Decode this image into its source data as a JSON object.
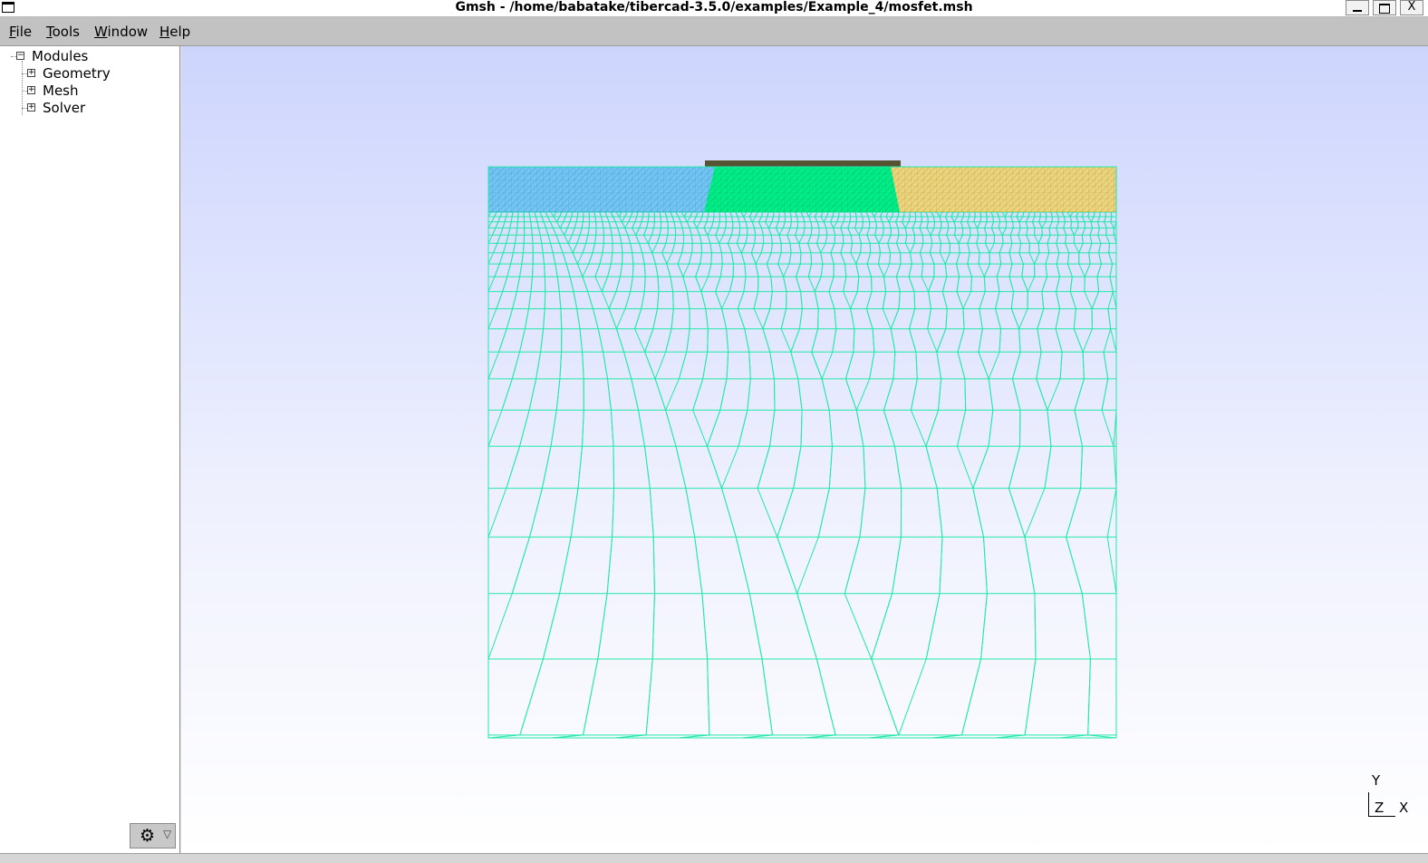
{
  "window": {
    "title": "Gmsh - /home/babatake/tibercad-3.5.0/examples/Example_4/mosfet.msh",
    "close_glyph": "X"
  },
  "menubar": {
    "items": [
      {
        "label": "File",
        "mnemonic": "F",
        "rest": "ile"
      },
      {
        "label": "Tools",
        "mnemonic": "T",
        "rest": "ools"
      },
      {
        "label": "Window",
        "mnemonic": "W",
        "rest": "indow"
      },
      {
        "label": "Help",
        "mnemonic": "H",
        "rest": "elp"
      }
    ]
  },
  "tree": {
    "root": {
      "label": "Modules",
      "expanded": true
    },
    "children": [
      {
        "label": "Geometry",
        "expanded": false
      },
      {
        "label": "Mesh",
        "expanded": false
      },
      {
        "label": "Solver",
        "expanded": false
      }
    ]
  },
  "options_button": {
    "icon": "gear-icon",
    "dropdown_icon": "triangle-down-icon"
  },
  "axes": {
    "y": "Y",
    "z": "Z",
    "x": "X"
  },
  "colors": {
    "source_region": "#1ab0ee",
    "channel_region": "#00ee88",
    "drain_region": "#ffcc11",
    "substrate_mesh": "#22e8a8",
    "gate_oxide": "#555533"
  }
}
